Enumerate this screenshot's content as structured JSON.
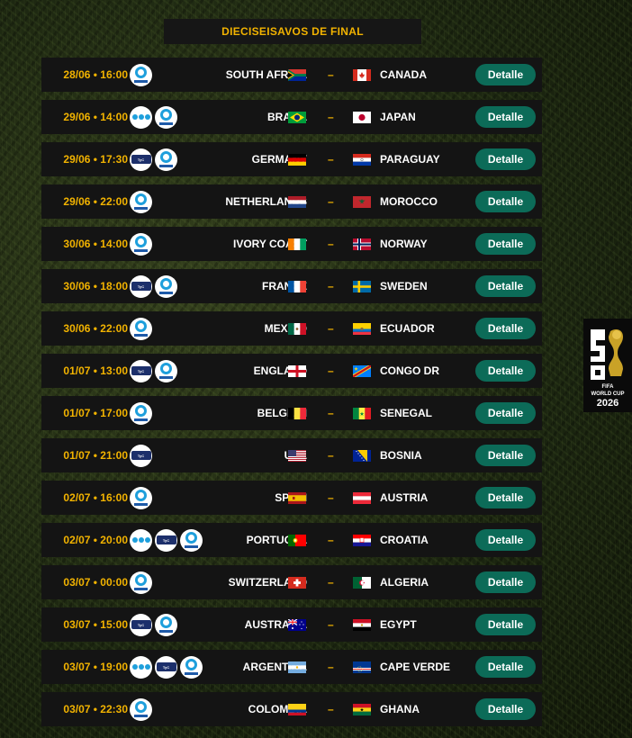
{
  "stage_title": "DIECISEISAVOS DE FINAL",
  "button_label": "Detalle",
  "brand": {
    "line1": "FIFA",
    "line2": "WORLD CUP",
    "line3": "2026"
  },
  "colors": {
    "accent": "#f2b300",
    "button": "#0c6b58",
    "row_bg": "#141414"
  },
  "matches": [
    {
      "date": "28/06 • 16:00",
      "channels": [
        "dsports"
      ],
      "home": "SOUTH AFRICA",
      "home_flag": "za",
      "away": "CANADA",
      "away_flag": "ca"
    },
    {
      "date": "29/06 • 14:00",
      "channels": [
        "telefe",
        "dsports"
      ],
      "home": "BRAZIL",
      "home_flag": "br",
      "away": "JAPAN",
      "away_flag": "jp"
    },
    {
      "date": "29/06 • 17:30",
      "channels": [
        "tyc",
        "dsports"
      ],
      "home": "GERMANY",
      "home_flag": "de",
      "away": "PARAGUAY",
      "away_flag": "py"
    },
    {
      "date": "29/06 • 22:00",
      "channels": [
        "dsports"
      ],
      "home": "NETHERLANDS",
      "home_flag": "nl",
      "away": "MOROCCO",
      "away_flag": "ma"
    },
    {
      "date": "30/06 • 14:00",
      "channels": [
        "dsports"
      ],
      "home": "IVORY COAST",
      "home_flag": "ci",
      "away": "NORWAY",
      "away_flag": "no"
    },
    {
      "date": "30/06 • 18:00",
      "channels": [
        "tyc",
        "dsports"
      ],
      "home": "FRANCE",
      "home_flag": "fr",
      "away": "SWEDEN",
      "away_flag": "se"
    },
    {
      "date": "30/06 • 22:00",
      "channels": [
        "dsports"
      ],
      "home": "MEXICO",
      "home_flag": "mx",
      "away": "ECUADOR",
      "away_flag": "ec"
    },
    {
      "date": "01/07 • 13:00",
      "channels": [
        "tyc",
        "dsports"
      ],
      "home": "ENGLAND",
      "home_flag": "en",
      "away": "CONGO DR",
      "away_flag": "cd"
    },
    {
      "date": "01/07 • 17:00",
      "channels": [
        "dsports"
      ],
      "home": "BELGIUM",
      "home_flag": "be",
      "away": "SENEGAL",
      "away_flag": "sn"
    },
    {
      "date": "01/07 • 21:00",
      "channels": [
        "tyc"
      ],
      "home": "USA",
      "home_flag": "us",
      "away": "BOSNIA",
      "away_flag": "ba"
    },
    {
      "date": "02/07 • 16:00",
      "channels": [
        "dsports"
      ],
      "home": "SPAIN",
      "home_flag": "es",
      "away": "AUSTRIA",
      "away_flag": "at"
    },
    {
      "date": "02/07 • 20:00",
      "channels": [
        "telefe",
        "tyc",
        "dsports"
      ],
      "home": "PORTUGAL",
      "home_flag": "pt",
      "away": "CROATIA",
      "away_flag": "hr"
    },
    {
      "date": "03/07 • 00:00",
      "channels": [
        "dsports"
      ],
      "home": "SWITZERLAND",
      "home_flag": "ch",
      "away": "ALGERIA",
      "away_flag": "dz"
    },
    {
      "date": "03/07 • 15:00",
      "channels": [
        "tyc",
        "dsports"
      ],
      "home": "AUSTRALIA",
      "home_flag": "au",
      "away": "EGYPT",
      "away_flag": "eg"
    },
    {
      "date": "03/07 • 19:00",
      "channels": [
        "telefe",
        "tyc",
        "dsports"
      ],
      "home": "ARGENTINA",
      "home_flag": "ar",
      "away": "CAPE VERDE",
      "away_flag": "cv"
    },
    {
      "date": "03/07 • 22:30",
      "channels": [
        "dsports"
      ],
      "home": "COLOMBIA",
      "home_flag": "co",
      "away": "GHANA",
      "away_flag": "gh"
    }
  ]
}
